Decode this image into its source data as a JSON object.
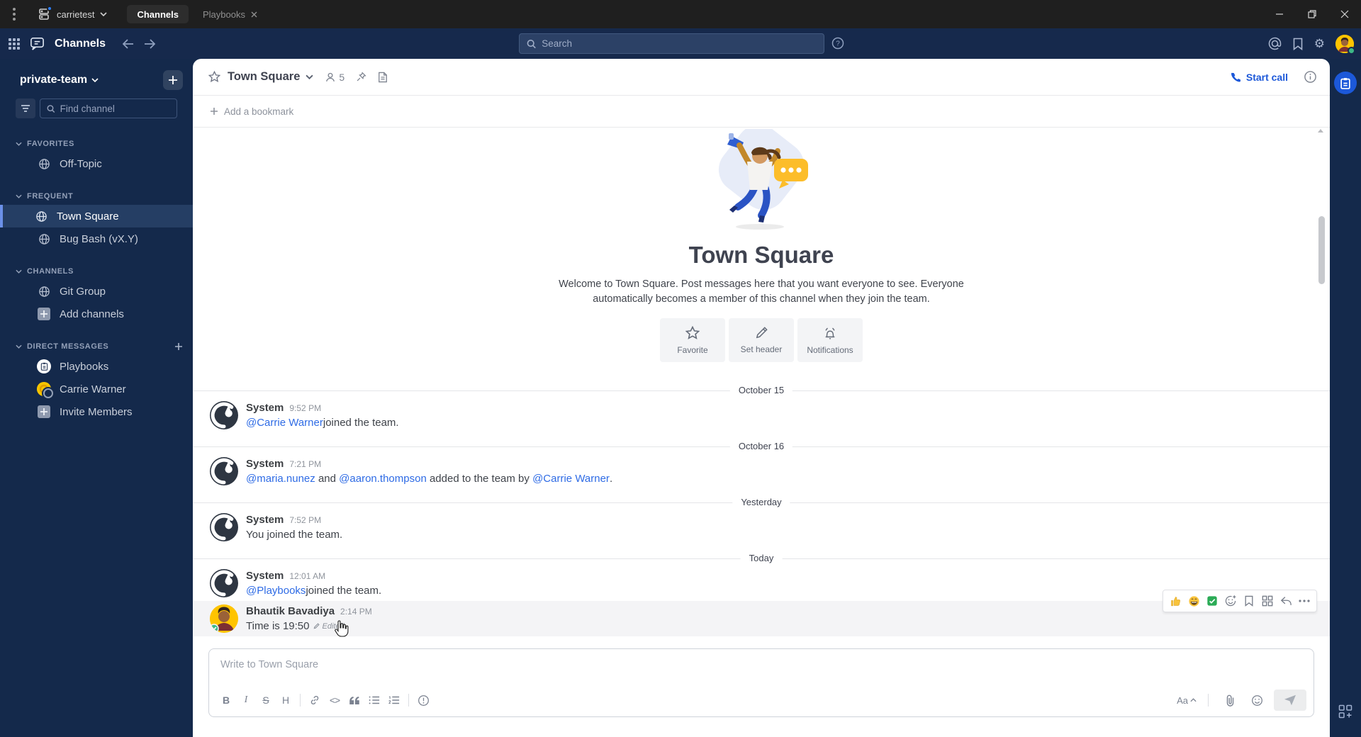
{
  "colors": {
    "accent": "#1c58d9",
    "sidebar_bg": "#14294b",
    "titlebar_bg": "#1f1f1f",
    "link": "#2e6be5",
    "selected_channel_bar": "#6b90e8"
  },
  "titlebar": {
    "team_menu": "carrietest",
    "tabs": [
      {
        "label": "Channels",
        "active": true
      },
      {
        "label": "Playbooks",
        "active": false
      }
    ]
  },
  "header": {
    "product_title": "Channels",
    "search_placeholder": "Search"
  },
  "sidebar": {
    "team": "private-team",
    "find_placeholder": "Find channel",
    "sections": [
      {
        "label": "FAVORITES",
        "items": [
          {
            "label": "Off-Topic"
          }
        ]
      },
      {
        "label": "FREQUENT",
        "items": [
          {
            "label": "Town Square",
            "selected": true
          },
          {
            "label": "Bug Bash (vX.Y)"
          }
        ]
      },
      {
        "label": "CHANNELS",
        "items": [
          {
            "label": "Git Group"
          },
          {
            "label": "Add channels"
          }
        ]
      },
      {
        "label": "DIRECT MESSAGES",
        "items": [
          {
            "label": "Playbooks"
          },
          {
            "label": "Carrie Warner"
          },
          {
            "label": "Invite Members"
          }
        ]
      }
    ]
  },
  "channel_header": {
    "name": "Town Square",
    "members": "5",
    "start_call": "Start call"
  },
  "bookmarks": {
    "add_label": "Add a bookmark"
  },
  "intro": {
    "title": "Town Square",
    "description": "Welcome to Town Square. Post messages here that you want everyone to see. Everyone automatically becomes a member of this channel when they join the team.",
    "actions": [
      {
        "label": "Favorite"
      },
      {
        "label": "Set header"
      },
      {
        "label": "Notifications"
      }
    ]
  },
  "feed": {
    "separators": [
      "October 15",
      "October 16",
      "Yesterday",
      "Today"
    ],
    "messages": [
      {
        "author": "System",
        "time": "9:52 PM",
        "parts": {
          "mention": "@Carrie Warner",
          "text": " joined the team."
        }
      },
      {
        "author": "System",
        "time": "7:21 PM",
        "parts": {
          "m1": "@maria.nunez",
          "t1": " and ",
          "m2": "@aaron.thompson",
          "t2": " added to the team by ",
          "m3": "@Carrie Warner",
          "t3": "."
        }
      },
      {
        "author": "System",
        "time": "7:52 PM",
        "parts": {
          "text": "You joined the team."
        }
      },
      {
        "author": "System",
        "time": "12:01 AM",
        "parts": {
          "mention": "@Playbooks",
          "text": " joined the team."
        }
      },
      {
        "author": "Bhautik Bavadiya",
        "time": "2:14 PM",
        "parts": {
          "text": "Time is 19:50",
          "edited": "Edited"
        }
      }
    ]
  },
  "editor": {
    "placeholder": "Write to Town Square",
    "toolbar": {
      "bold": "B",
      "italic": "I",
      "strike": "S",
      "heading": "H",
      "code": "<>",
      "format_toggle": "Aa"
    }
  }
}
